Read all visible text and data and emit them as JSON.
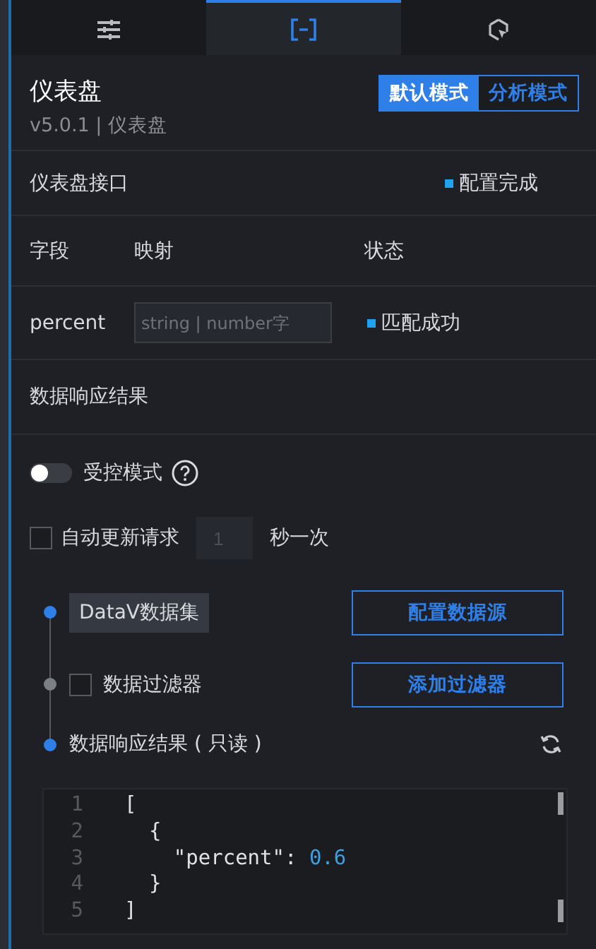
{
  "tabs": [
    {
      "kind": "sliders",
      "selected": false
    },
    {
      "kind": "bracket",
      "selected": true
    },
    {
      "kind": "cursor",
      "selected": false
    }
  ],
  "header": {
    "title": "仪表盘",
    "version": "v5.0.1 | 仪表盘",
    "modes": [
      {
        "label": "默认模式",
        "selected": true
      },
      {
        "label": "分析模式",
        "selected": false
      }
    ]
  },
  "interface": {
    "title": "仪表盘接口",
    "status": "配置完成",
    "columns": [
      "字段",
      "映射",
      "状态"
    ],
    "rows": [
      {
        "field": "percent",
        "placeholder": "string | number字",
        "status": "匹配成功"
      }
    ]
  },
  "response_title": "数据响应结果",
  "controlled_mode": {
    "label": "受控模式",
    "on": false
  },
  "auto_update": {
    "label": "自动更新请求",
    "checked": false,
    "value": "1",
    "unit": "秒一次"
  },
  "steps": [
    {
      "kind": "source",
      "label": "DataV数据集",
      "button": "配置数据源",
      "active": true
    },
    {
      "kind": "filter",
      "label": "数据过滤器",
      "checked": false,
      "button": "添加过滤器",
      "active": false
    },
    {
      "kind": "result",
      "label": "数据响应结果 ( 只读 )",
      "active": true
    }
  ],
  "code_lines": [
    {
      "number": "1",
      "code": "["
    },
    {
      "number": "2",
      "code": "  {"
    },
    {
      "number": "3",
      "code": "    \"percent\": ",
      "value": "0.6"
    },
    {
      "number": "4",
      "code": "  }"
    },
    {
      "number": "5",
      "code": "]"
    }
  ]
}
